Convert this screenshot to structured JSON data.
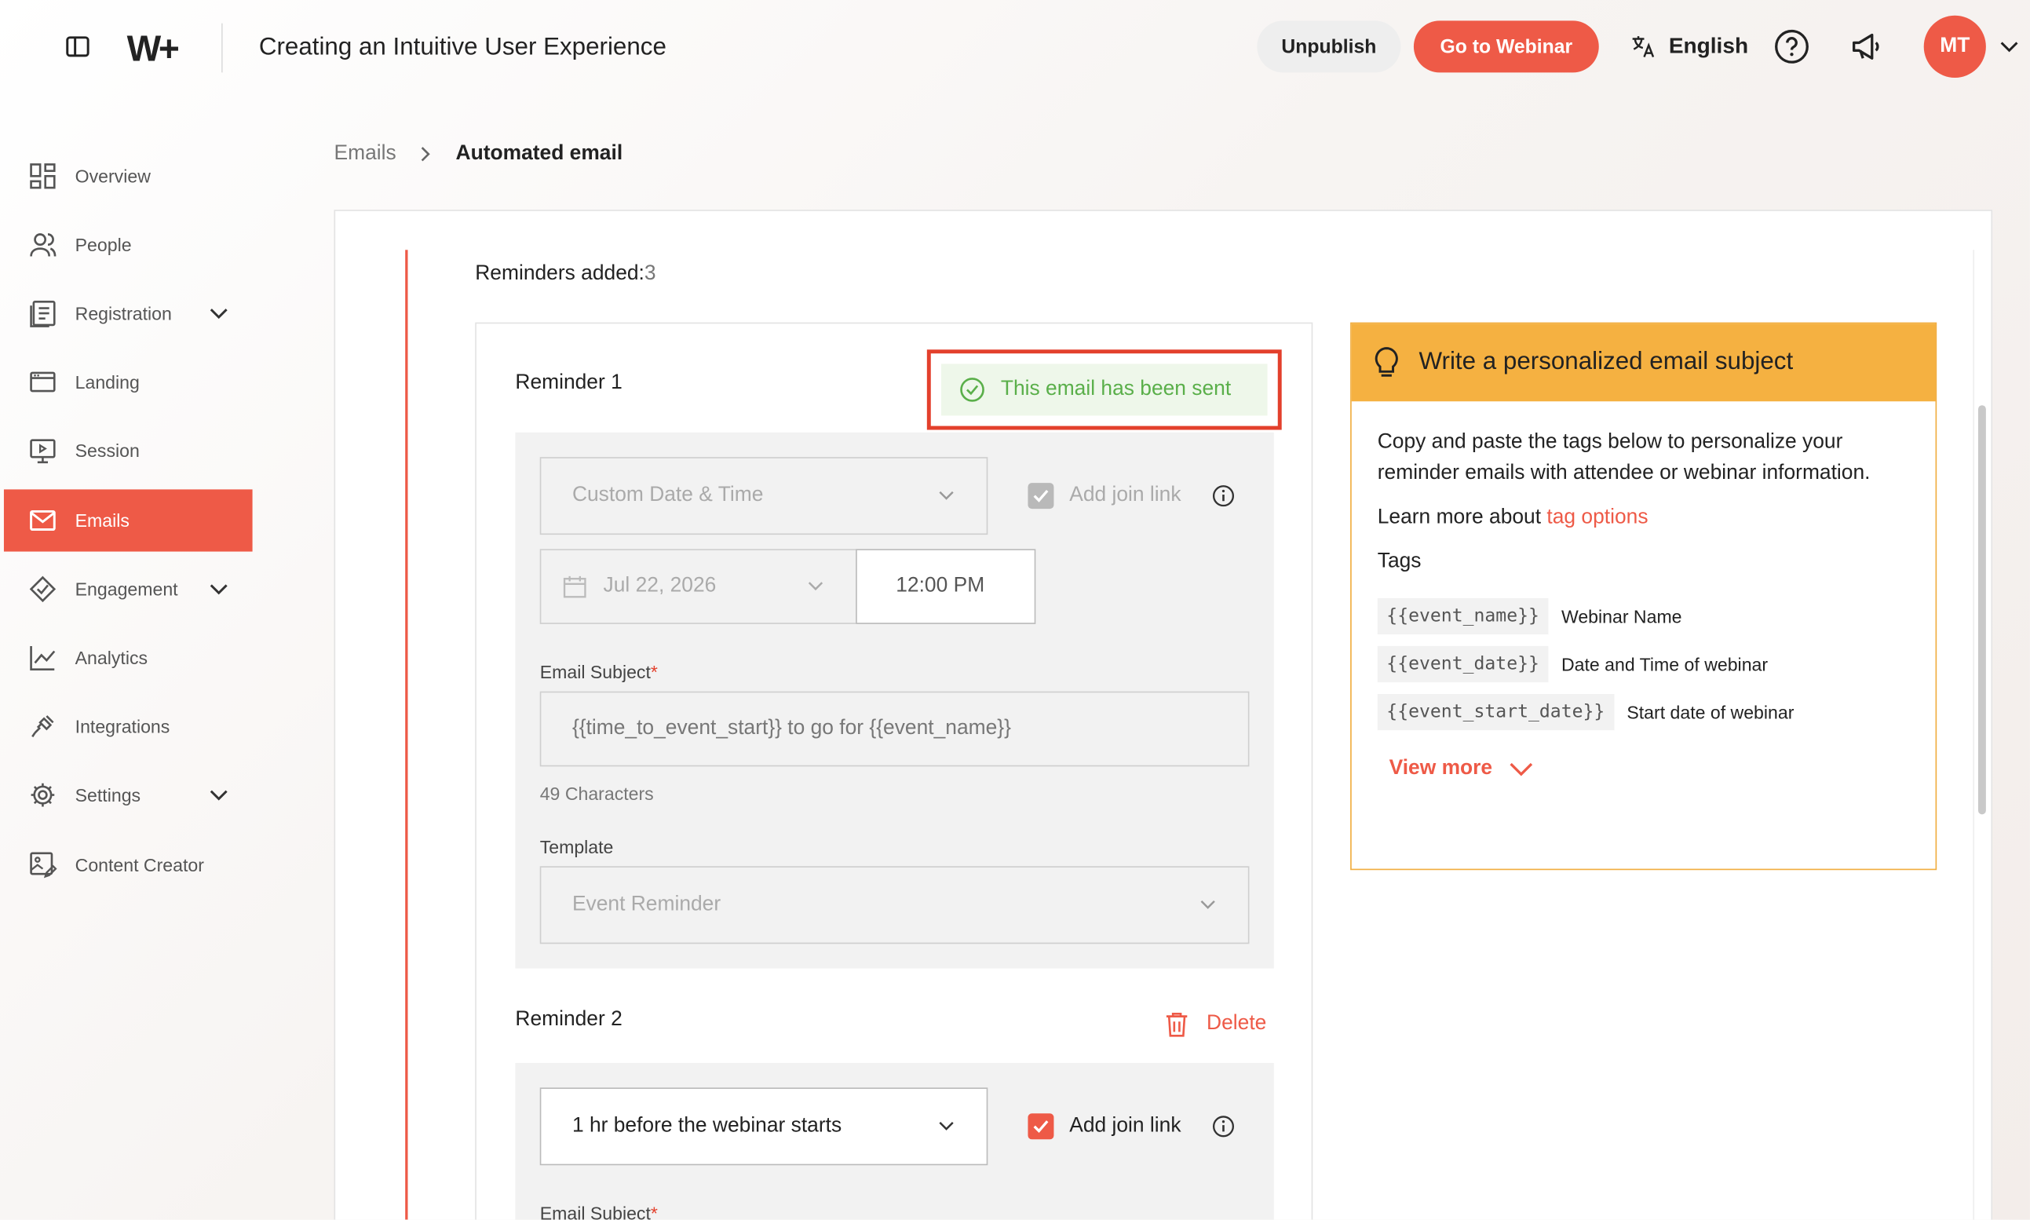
{
  "header": {
    "logo": "W+",
    "title": "Creating an Intuitive User Experience",
    "unpublish_label": "Unpublish",
    "goto_label": "Go to Webinar",
    "language": "English",
    "avatar_initials": "MT"
  },
  "sidebar": {
    "items": [
      {
        "label": "Overview",
        "icon": "grid-icon"
      },
      {
        "label": "People",
        "icon": "people-icon"
      },
      {
        "label": "Registration",
        "icon": "form-icon",
        "expandable": true
      },
      {
        "label": "Landing",
        "icon": "window-icon"
      },
      {
        "label": "Session",
        "icon": "monitor-play-icon"
      },
      {
        "label": "Emails",
        "icon": "mail-icon",
        "active": true
      },
      {
        "label": "Engagement",
        "icon": "engagement-icon",
        "expandable": true
      },
      {
        "label": "Analytics",
        "icon": "chart-icon"
      },
      {
        "label": "Integrations",
        "icon": "plug-icon"
      },
      {
        "label": "Settings",
        "icon": "gear-icon",
        "expandable": true
      },
      {
        "label": "Content Creator",
        "icon": "image-edit-icon"
      }
    ]
  },
  "breadcrumb": {
    "parent": "Emails",
    "current": "Automated email"
  },
  "main": {
    "reminders_added_label": "Reminders added:",
    "reminders_added_count": "3",
    "reminder1": {
      "title": "Reminder 1",
      "sent_status": "This email has been sent",
      "timing": "Custom Date & Time",
      "add_join_link": "Add join link",
      "date": "Jul 22, 2026",
      "time": "12:00 PM",
      "email_subject_label": "Email Subject",
      "email_subject_value": "{{time_to_event_start}} to go for {{event_name}}",
      "char_count": "49 Characters",
      "template_label": "Template",
      "template_value": "Event Reminder"
    },
    "reminder2": {
      "title": "Reminder 2",
      "delete_label": "Delete",
      "timing": "1 hr before the webinar starts",
      "add_join_link": "Add join link",
      "email_subject_label": "Email Subject"
    }
  },
  "tip": {
    "title": "Write a personalized email subject",
    "description": "Copy and paste the tags below to personalize your reminder emails with attendee or webinar information.",
    "learn_more_prefix": "Learn more about",
    "learn_more_link": "tag options",
    "tags_label": "Tags",
    "tags": [
      {
        "code": "{{event_name}}",
        "desc": "Webinar Name"
      },
      {
        "code": "{{event_date}}",
        "desc": "Date and Time of webinar"
      },
      {
        "code": "{{event_start_date}}",
        "desc": "Start date of webinar"
      }
    ],
    "view_more": "View more"
  },
  "colors": {
    "accent": "#ee5a47",
    "sent_green": "#5aaf4a",
    "tip_header": "#f5b141"
  }
}
